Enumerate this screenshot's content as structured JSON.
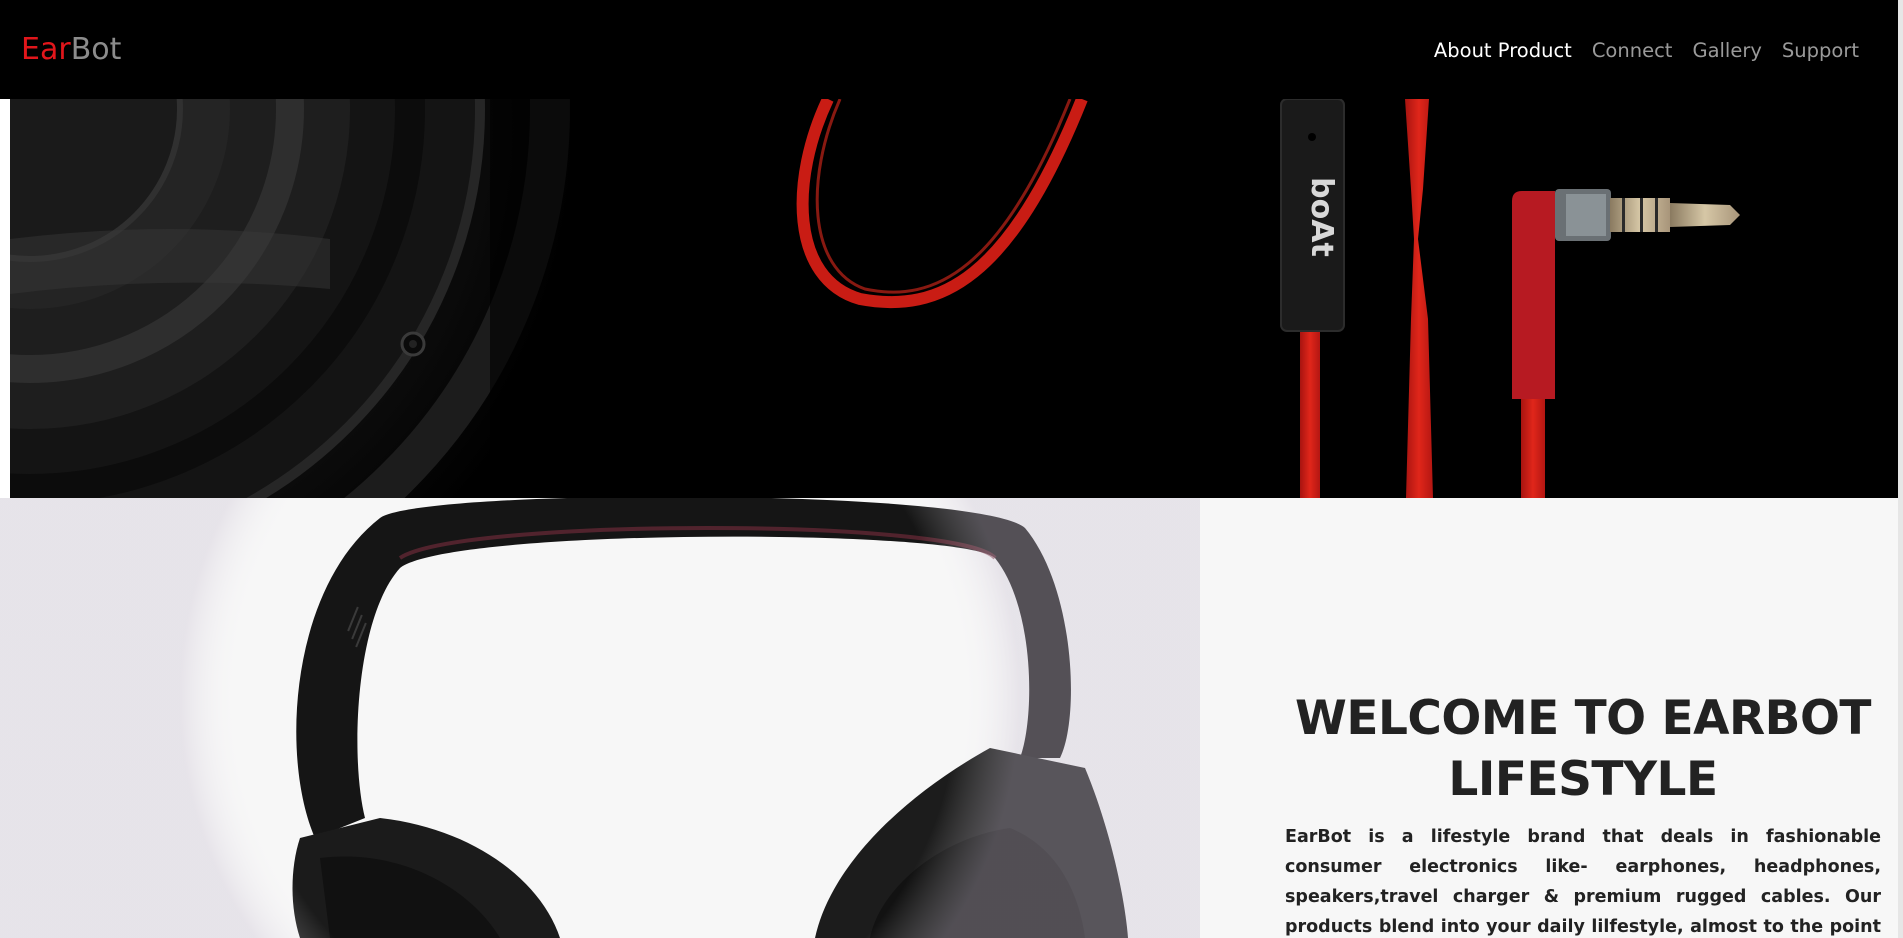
{
  "brand": {
    "part1": "Ear",
    "part2": "Bot",
    "color_primary": "#e1161b",
    "color_secondary": "#8c8c8c"
  },
  "nav": {
    "items": [
      {
        "label": "About Product",
        "active": true
      },
      {
        "label": "Connect",
        "active": false
      },
      {
        "label": "Gallery",
        "active": false
      },
      {
        "label": "Support",
        "active": false
      }
    ]
  },
  "hero": {
    "cable_brand_text": "boAt",
    "accent_color": "#d01a12"
  },
  "welcome": {
    "title_line1": "WELCOME TO EARBOT",
    "title_line2": "LIFESTYLE",
    "description": "EarBot is a lifestyle brand that deals in fashionable consumer electronics like- earphones, headphones, speakers,travel charger & premium rugged cables. Our products blend into your daily lilfestyle, almost to the point of being a fashion"
  }
}
